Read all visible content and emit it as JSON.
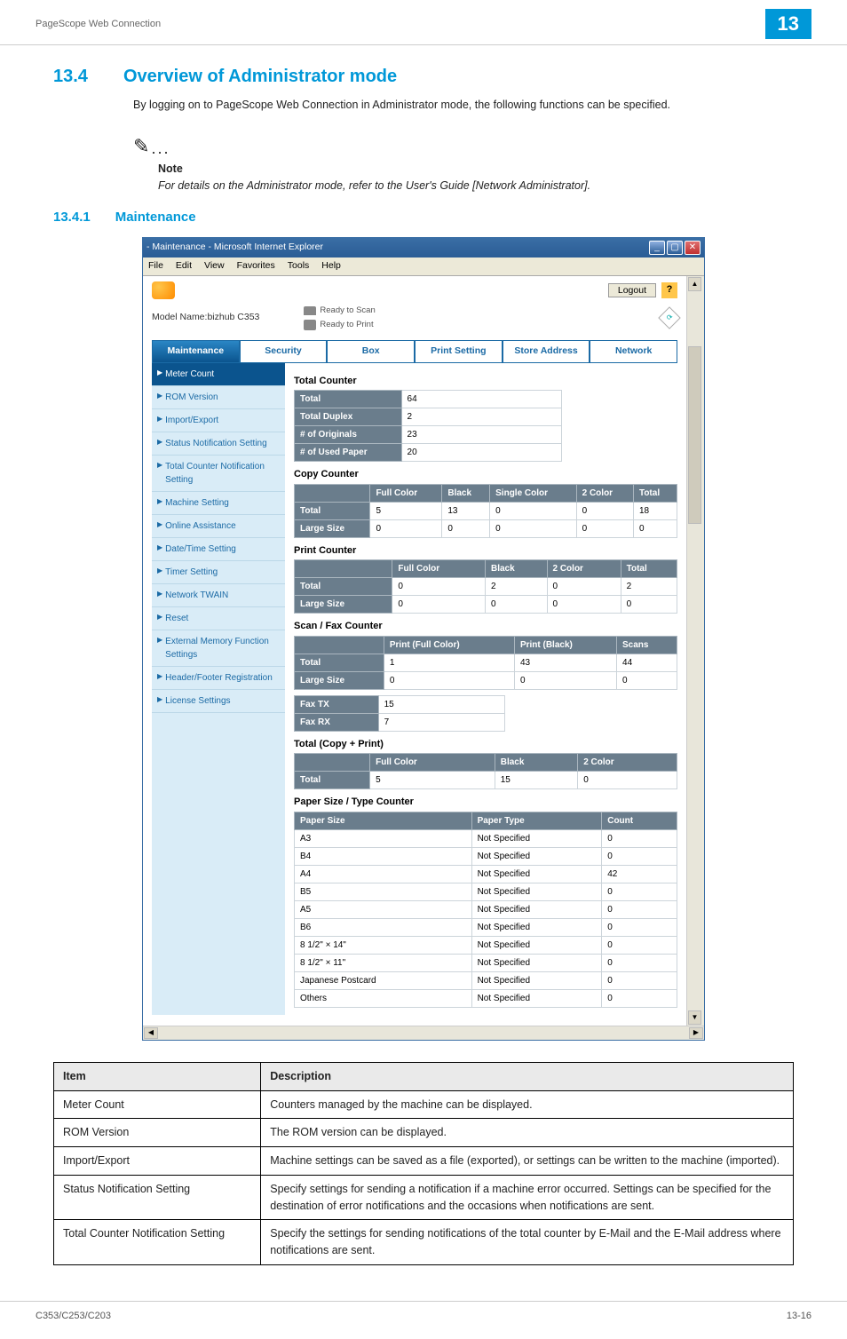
{
  "header": {
    "running_title": "PageScope Web Connection",
    "chapter": "13"
  },
  "section": {
    "number": "13.4",
    "title": "Overview of Administrator mode",
    "intro": "By logging on to PageScope Web Connection in Administrator mode, the following functions can be specified."
  },
  "note": {
    "label": "Note",
    "text": "For details on the Administrator mode, refer to the User's Guide [Network Administrator]."
  },
  "subsection": {
    "number": "13.4.1",
    "title": "Maintenance"
  },
  "screenshot": {
    "window_title": "- Maintenance - Microsoft Internet Explorer",
    "menus": [
      "File",
      "Edit",
      "View",
      "Favorites",
      "Tools",
      "Help"
    ],
    "logout": "Logout",
    "help": "?",
    "model_label": "Model Name:bizhub C353",
    "status_scan": "Ready to Scan",
    "status_print": "Ready to Print",
    "tabs": [
      "Maintenance",
      "Security",
      "Box",
      "Print Setting",
      "Store Address",
      "Network"
    ],
    "active_tab": 0,
    "sidebar": [
      "Meter Count",
      "ROM Version",
      "Import/Export",
      "Status Notification Setting",
      "Total Counter Notification Setting",
      "Machine Setting",
      "Online Assistance",
      "Date/Time Setting",
      "Timer Setting",
      "Network TWAIN",
      "Reset",
      "External Memory Function Settings",
      "Header/Footer Registration",
      "License Settings"
    ],
    "selected_sidebar": 0,
    "groups": {
      "total_counter": {
        "title": "Total Counter",
        "rows": [
          {
            "k": "Total",
            "v": "64"
          },
          {
            "k": "Total Duplex",
            "v": "2"
          },
          {
            "k": "# of Originals",
            "v": "23"
          },
          {
            "k": "# of Used Paper",
            "v": "20"
          }
        ]
      },
      "copy_counter": {
        "title": "Copy Counter",
        "head": [
          "",
          "Full Color",
          "Black",
          "Single Color",
          "2 Color",
          "Total"
        ],
        "rows": [
          [
            "Total",
            "5",
            "13",
            "0",
            "0",
            "18"
          ],
          [
            "Large Size",
            "0",
            "0",
            "0",
            "0",
            "0"
          ]
        ]
      },
      "print_counter": {
        "title": "Print Counter",
        "head": [
          "",
          "Full Color",
          "Black",
          "2 Color",
          "Total"
        ],
        "rows": [
          [
            "Total",
            "0",
            "2",
            "0",
            "2"
          ],
          [
            "Large Size",
            "0",
            "0",
            "0",
            "0"
          ]
        ]
      },
      "scan_fax_counter": {
        "title": "Scan / Fax Counter",
        "head": [
          "",
          "Print (Full Color)",
          "Print (Black)",
          "Scans"
        ],
        "rows": [
          [
            "Total",
            "1",
            "43",
            "44"
          ],
          [
            "Large Size",
            "0",
            "0",
            "0"
          ]
        ]
      },
      "fax": {
        "rows": [
          {
            "k": "Fax TX",
            "v": "15"
          },
          {
            "k": "Fax RX",
            "v": "7"
          }
        ]
      },
      "total_cp": {
        "title": "Total (Copy + Print)",
        "head": [
          "",
          "Full Color",
          "Black",
          "2 Color"
        ],
        "rows": [
          [
            "Total",
            "5",
            "15",
            "0"
          ]
        ]
      },
      "paper_size": {
        "title": "Paper Size / Type Counter",
        "head": [
          "Paper Size",
          "Paper Type",
          "Count"
        ],
        "rows": [
          [
            "A3",
            "Not Specified",
            "0"
          ],
          [
            "B4",
            "Not Specified",
            "0"
          ],
          [
            "A4",
            "Not Specified",
            "42"
          ],
          [
            "B5",
            "Not Specified",
            "0"
          ],
          [
            "A5",
            "Not Specified",
            "0"
          ],
          [
            "B6",
            "Not Specified",
            "0"
          ],
          [
            "8 1/2\" × 14\"",
            "Not Specified",
            "0"
          ],
          [
            "8 1/2\" × 11\"",
            "Not Specified",
            "0"
          ],
          [
            "Japanese Postcard",
            "Not Specified",
            "0"
          ],
          [
            "Others",
            "Not Specified",
            "0"
          ]
        ]
      }
    }
  },
  "desc_table": {
    "head": [
      "Item",
      "Description"
    ],
    "rows": [
      [
        "Meter Count",
        "Counters managed by the machine can be displayed."
      ],
      [
        "ROM Version",
        "The ROM version can be displayed."
      ],
      [
        "Import/Export",
        "Machine settings can be saved as a file (exported), or settings can be written to the machine (imported)."
      ],
      [
        "Status Notification Setting",
        "Specify settings for sending a notification if a machine error occurred. Settings can be specified for the destination of error notifications and the occasions when notifications are sent."
      ],
      [
        "Total Counter Notification Setting",
        "Specify the settings for sending notifications of the total counter by E-Mail and the E-Mail address where notifications are sent."
      ]
    ]
  },
  "footer": {
    "left": "C353/C253/C203",
    "right": "13-16"
  }
}
